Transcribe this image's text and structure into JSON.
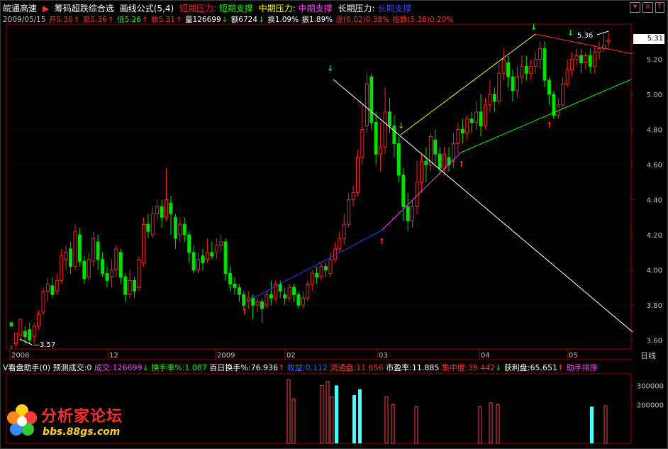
{
  "titlebar": {
    "title": "皖通高速",
    "formula1": "筹码超跌综合选",
    "formula2": "画线公式(5,4)",
    "short_pressure": "短期压力:",
    "short_support": "短期支撑",
    "mid_pressure": "中期压力:",
    "mid_support": "中期支撑",
    "long_pressure": "长期压力:",
    "long_support": "长期支撑"
  },
  "infobar": {
    "date": "2009/05/15",
    "open": "开5.30",
    "high": "高5.36",
    "low": "低5.26",
    "close": "收5.31",
    "volume": "量126699",
    "amount": "额6724",
    "turnover": "换1.09%",
    "amplitude": "振1.89%",
    "change": "涨(0.02)0.38%",
    "index": "指数(5.38)0.20%"
  },
  "price_axis": {
    "labels": [
      "5.20",
      "5.00",
      "4.80",
      "4.60",
      "4.40",
      "4.20",
      "4.00",
      "3.80",
      "3.60"
    ],
    "current_price": "5.31"
  },
  "annotations": {
    "high_label": "5.36",
    "low_label": "3.57"
  },
  "date_axis": {
    "labels": [
      "2008",
      "12",
      "2009",
      "02",
      "03",
      "04",
      "05"
    ],
    "period": "日线"
  },
  "indicator_bar": {
    "name": "V看盘助手(0)",
    "forecast": "预测成交:0",
    "volume": "成交:126699",
    "turnover_rate": "换手率%:1.087",
    "hundred_day": "百日换手%:76.936",
    "income": "收益:0.112",
    "float": "流通盘:11.656",
    "pe": "市盈率:11.885",
    "concentration": "集中度:39.442",
    "profit": "获利盘:65.651",
    "rank": "助手排序"
  },
  "volume_axis": {
    "labels": [
      "300000",
      "200000"
    ]
  },
  "logo": {
    "text": "分析家论坛",
    "url": "bbs.88gs.com"
  },
  "colors": {
    "up": "#ff2020",
    "down": "#00e000",
    "grid": "#7a0000",
    "axis": "#a00000",
    "text_red": "#ff3030",
    "text_green": "#00ff00",
    "text_yellow": "#ffff00",
    "text_magenta": "#ff40ff",
    "text_white": "#ffffff"
  },
  "chart_data": {
    "type": "candlestick",
    "ylim": [
      3.55,
      5.4
    ],
    "candles": [
      [
        3.7,
        3.68,
        3.55,
        3.57
      ],
      [
        3.58,
        3.64,
        3.56,
        3.63
      ],
      [
        3.63,
        3.72,
        3.6,
        3.64
      ],
      [
        3.65,
        3.62,
        3.58,
        3.68
      ],
      [
        3.66,
        3.6,
        3.58,
        3.7
      ],
      [
        3.62,
        3.68,
        3.58,
        3.7
      ],
      [
        3.68,
        3.75,
        3.66,
        3.77
      ],
      [
        3.76,
        3.88,
        3.74,
        3.9
      ],
      [
        3.88,
        3.92,
        3.82,
        3.95
      ],
      [
        3.91,
        3.86,
        3.84,
        3.96
      ],
      [
        3.88,
        3.94,
        3.86,
        3.98
      ],
      [
        3.94,
        4.08,
        3.92,
        4.12
      ],
      [
        4.06,
        4.1,
        4.0,
        4.14
      ],
      [
        4.12,
        4.02,
        3.98,
        4.16
      ],
      [
        4.02,
        4.22,
        4.0,
        4.26
      ],
      [
        4.2,
        4.05,
        4.02,
        4.24
      ],
      [
        4.05,
        3.95,
        3.92,
        4.08
      ],
      [
        3.96,
        4.06,
        3.94,
        4.1
      ],
      [
        4.05,
        4.18,
        4.02,
        4.22
      ],
      [
        4.16,
        4.06,
        4.0,
        4.2
      ],
      [
        4.06,
        3.98,
        3.96,
        4.1
      ],
      [
        3.98,
        3.94,
        3.9,
        4.02
      ],
      [
        3.96,
        4.0,
        3.9,
        4.06
      ],
      [
        4.0,
        4.12,
        3.96,
        4.14
      ],
      [
        4.1,
        3.96,
        3.92,
        4.12
      ],
      [
        3.96,
        3.86,
        3.82,
        3.98
      ],
      [
        3.86,
        3.94,
        3.84,
        4.0
      ],
      [
        3.94,
        3.88,
        3.84,
        3.96
      ],
      [
        3.9,
        4.06,
        3.88,
        4.08
      ],
      [
        4.04,
        4.26,
        4.02,
        4.3
      ],
      [
        4.26,
        4.22,
        4.18,
        4.32
      ],
      [
        4.2,
        4.32,
        4.18,
        4.36
      ],
      [
        4.32,
        4.36,
        4.28,
        4.4
      ],
      [
        4.36,
        4.3,
        4.24,
        4.4
      ],
      [
        4.3,
        4.4,
        4.28,
        4.58
      ],
      [
        4.38,
        4.32,
        4.2,
        4.42
      ],
      [
        4.3,
        4.18,
        4.12,
        4.32
      ],
      [
        4.2,
        4.26,
        4.16,
        4.3
      ],
      [
        4.26,
        4.2,
        4.16,
        4.3
      ],
      [
        4.2,
        4.1,
        4.04,
        4.22
      ],
      [
        4.1,
        4.0,
        3.98,
        4.14
      ],
      [
        4.0,
        4.06,
        3.98,
        4.1
      ],
      [
        4.08,
        4.04,
        4.0,
        4.12
      ],
      [
        4.06,
        4.1,
        4.04,
        4.18
      ],
      [
        4.1,
        4.08,
        4.06,
        4.16
      ],
      [
        4.1,
        4.14,
        4.06,
        4.18
      ],
      [
        4.14,
        4.16,
        4.1,
        4.2
      ],
      [
        4.16,
        3.98,
        3.94,
        4.18
      ],
      [
        3.98,
        3.92,
        3.88,
        4.02
      ],
      [
        3.92,
        3.9,
        3.86,
        3.96
      ],
      [
        3.9,
        3.86,
        3.82,
        3.92
      ],
      [
        3.86,
        3.8,
        3.78,
        3.88
      ],
      [
        3.82,
        3.84,
        3.78,
        3.88
      ],
      [
        3.84,
        3.8,
        3.72,
        3.86
      ],
      [
        3.8,
        3.82,
        3.76,
        3.84
      ],
      [
        3.82,
        3.78,
        3.7,
        3.84
      ],
      [
        3.8,
        3.86,
        3.78,
        3.88
      ],
      [
        3.86,
        3.84,
        3.8,
        3.94
      ],
      [
        3.84,
        3.92,
        3.82,
        3.94
      ],
      [
        3.92,
        3.88,
        3.84,
        3.94
      ],
      [
        3.86,
        3.84,
        3.8,
        3.9
      ],
      [
        3.84,
        3.9,
        3.82,
        3.92
      ],
      [
        3.9,
        3.86,
        3.82,
        3.92
      ],
      [
        3.86,
        3.8,
        3.78,
        3.88
      ],
      [
        3.8,
        3.84,
        3.78,
        3.88
      ],
      [
        3.84,
        3.92,
        3.82,
        3.94
      ],
      [
        3.92,
        3.98,
        3.88,
        4.0
      ],
      [
        3.98,
        3.96,
        3.92,
        4.02
      ],
      [
        3.96,
        4.02,
        3.94,
        4.04
      ],
      [
        4.02,
        4.0,
        3.96,
        4.04
      ],
      [
        3.98,
        4.06,
        3.96,
        4.1
      ],
      [
        4.06,
        4.12,
        4.04,
        4.16
      ],
      [
        4.12,
        4.18,
        4.1,
        4.22
      ],
      [
        4.18,
        4.26,
        4.14,
        4.32
      ],
      [
        4.26,
        4.4,
        4.24,
        4.44
      ],
      [
        4.4,
        4.44,
        4.36,
        4.48
      ],
      [
        4.44,
        4.64,
        4.42,
        4.68
      ],
      [
        4.64,
        4.8,
        4.6,
        4.94
      ],
      [
        4.82,
        5.06,
        4.78,
        5.12
      ],
      [
        5.1,
        4.84,
        4.8,
        5.12
      ],
      [
        4.84,
        4.66,
        4.6,
        4.9
      ],
      [
        4.66,
        4.7,
        4.56,
        4.84
      ],
      [
        4.7,
        4.9,
        4.66,
        5.04
      ],
      [
        4.9,
        4.82,
        4.78,
        4.98
      ],
      [
        4.82,
        4.72,
        4.64,
        4.88
      ],
      [
        4.72,
        4.54,
        4.5,
        4.76
      ],
      [
        4.54,
        4.36,
        4.28,
        4.58
      ],
      [
        4.36,
        4.28,
        4.22,
        4.44
      ],
      [
        4.28,
        4.36,
        4.24,
        4.4
      ],
      [
        4.36,
        4.5,
        4.32,
        4.62
      ],
      [
        4.5,
        4.62,
        4.44,
        4.66
      ],
      [
        4.62,
        4.6,
        4.5,
        4.7
      ],
      [
        4.6,
        4.76,
        4.56,
        4.78
      ],
      [
        4.74,
        4.66,
        4.6,
        4.8
      ],
      [
        4.66,
        4.58,
        4.54,
        4.7
      ],
      [
        4.58,
        4.66,
        4.54,
        4.7
      ],
      [
        4.64,
        4.6,
        4.56,
        4.7
      ],
      [
        4.62,
        4.72,
        4.58,
        4.78
      ],
      [
        4.72,
        4.8,
        4.66,
        4.84
      ],
      [
        4.8,
        4.78,
        4.72,
        4.86
      ],
      [
        4.78,
        4.86,
        4.74,
        4.88
      ],
      [
        4.86,
        4.84,
        4.78,
        4.9
      ],
      [
        4.84,
        4.9,
        4.8,
        4.96
      ],
      [
        4.9,
        4.82,
        4.76,
        5.0
      ],
      [
        4.82,
        4.94,
        4.8,
        4.98
      ],
      [
        4.94,
        5.0,
        4.9,
        5.08
      ],
      [
        5.0,
        4.96,
        4.9,
        5.04
      ],
      [
        4.96,
        5.12,
        4.94,
        5.18
      ],
      [
        5.12,
        5.2,
        5.08,
        5.26
      ],
      [
        5.18,
        5.1,
        5.04,
        5.22
      ],
      [
        5.1,
        5.02,
        4.96,
        5.14
      ],
      [
        5.02,
        5.1,
        4.98,
        5.16
      ],
      [
        5.1,
        5.16,
        5.06,
        5.22
      ],
      [
        5.16,
        5.12,
        5.08,
        5.22
      ],
      [
        5.12,
        5.16,
        5.08,
        5.2
      ],
      [
        5.16,
        5.2,
        5.12,
        5.24
      ],
      [
        5.2,
        5.26,
        5.14,
        5.3
      ],
      [
        5.26,
        5.08,
        5.04,
        5.3
      ],
      [
        5.08,
        5.0,
        4.94,
        5.1
      ],
      [
        5.0,
        4.88,
        4.86,
        5.02
      ],
      [
        4.88,
        4.94,
        4.86,
        4.98
      ],
      [
        4.94,
        5.06,
        4.92,
        5.1
      ],
      [
        5.06,
        5.14,
        5.04,
        5.2
      ],
      [
        5.14,
        5.2,
        5.1,
        5.24
      ],
      [
        5.2,
        5.22,
        5.16,
        5.26
      ],
      [
        5.22,
        5.18,
        5.12,
        5.26
      ],
      [
        5.18,
        5.22,
        5.14,
        5.24
      ],
      [
        5.22,
        5.16,
        5.12,
        5.26
      ],
      [
        5.16,
        5.24,
        5.12,
        5.28
      ],
      [
        5.24,
        5.26,
        5.2,
        5.3
      ],
      [
        5.26,
        5.28,
        5.24,
        5.34
      ],
      [
        5.3,
        5.31,
        5.26,
        5.36
      ]
    ],
    "volume": {
      "ylim": [
        0,
        360000
      ],
      "bars": [
        [
          405,
          "up",
          330000
        ],
        [
          412,
          "up",
          230000
        ],
        [
          452,
          "up",
          300000
        ],
        [
          460,
          "up",
          320000
        ],
        [
          466,
          "up",
          240000
        ],
        [
          472,
          "down",
          300000
        ],
        [
          497,
          "down",
          250000
        ],
        [
          505,
          "down",
          280000
        ],
        [
          543,
          "up",
          240000
        ],
        [
          552,
          "up",
          200000
        ],
        [
          585,
          "up",
          190000
        ],
        [
          675,
          "up",
          190000
        ],
        [
          690,
          "up",
          210000
        ],
        [
          700,
          "up",
          200000
        ],
        [
          832,
          "down",
          190000
        ],
        [
          852,
          "up",
          195000
        ]
      ]
    }
  }
}
